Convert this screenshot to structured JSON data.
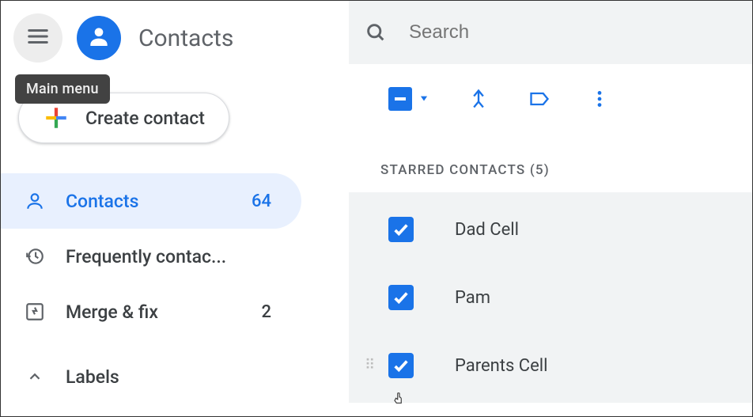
{
  "app": {
    "title": "Contacts"
  },
  "tooltip": {
    "main_menu": "Main menu"
  },
  "create": {
    "label": "Create contact"
  },
  "nav": {
    "contacts": {
      "label": "Contacts",
      "count": "64"
    },
    "frequent": {
      "label": "Frequently contac..."
    },
    "merge": {
      "label": "Merge & fix",
      "count": "2"
    },
    "labels": {
      "label": "Labels"
    }
  },
  "search": {
    "placeholder": "Search"
  },
  "section": {
    "starred_header": "STARRED CONTACTS (5)"
  },
  "contacts": [
    {
      "name": "Dad Cell",
      "checked": true
    },
    {
      "name": "Pam",
      "checked": true
    },
    {
      "name": "Parents Cell",
      "checked": true
    }
  ],
  "colors": {
    "primary": "#1a73e8",
    "muted": "#5f6368",
    "bg_search": "#f1f3f4"
  }
}
